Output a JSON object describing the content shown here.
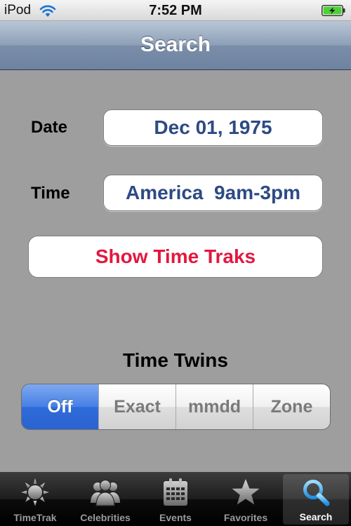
{
  "status_bar": {
    "carrier": "iPod",
    "time": "7:52 PM"
  },
  "nav": {
    "title": "Search"
  },
  "form": {
    "date_label": "Date",
    "date_value": "Dec 01, 1975",
    "time_label": "Time",
    "time_value": "America  9am-3pm",
    "show_button": "Show Time Traks"
  },
  "time_twins": {
    "heading": "Time Twins",
    "segments": [
      "Off",
      "Exact",
      "mmdd",
      "Zone"
    ],
    "selected": "Off"
  },
  "tab_bar": {
    "tabs": [
      {
        "label": "TimeTrak",
        "icon": "sun-icon"
      },
      {
        "label": "Celebrities",
        "icon": "people-icon"
      },
      {
        "label": "Events",
        "icon": "calendar-icon"
      },
      {
        "label": "Favorites",
        "icon": "star-icon"
      },
      {
        "label": "Search",
        "icon": "magnifier-icon"
      }
    ],
    "active": "Search"
  },
  "colors": {
    "accent_blue": "#2d4a84",
    "button_red": "#e3173f",
    "segment_selected": "#2f6bda",
    "battery_green": "#4cd137"
  }
}
